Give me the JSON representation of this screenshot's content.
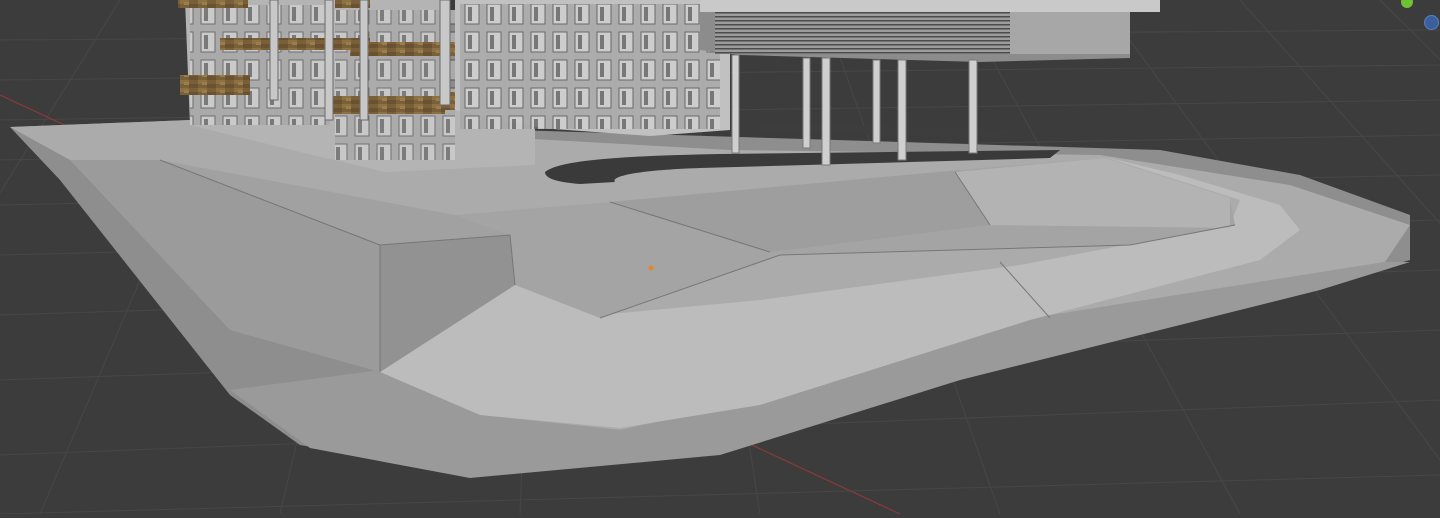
{
  "viewport": {
    "background": "#3c3c3c",
    "grid_color": "#474747",
    "axis_x_color": "#8a3a3a",
    "model_light": "#b4b4b4",
    "model_mid": "#a3a3a3",
    "model_dark": "#8c8c8c",
    "road_color": "#3a3a3a",
    "wood_color": "#7a6038",
    "origin_color": "#e08a2c"
  },
  "gizmo": {
    "green_dot_color": "#6fc233",
    "blue_dot_color": "#3b5f9e"
  }
}
